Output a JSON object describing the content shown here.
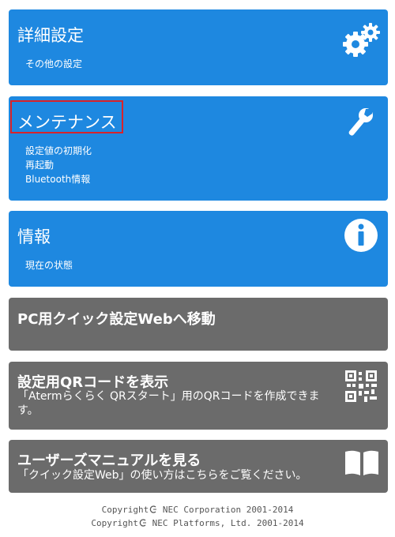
{
  "menu": {
    "advanced": {
      "title": "詳細設定",
      "items": [
        "その他の設定"
      ]
    },
    "maintenance": {
      "title": "メンテナンス",
      "items": [
        "設定値の初期化",
        "再起動",
        "Bluetooth情報"
      ]
    },
    "info": {
      "title": "情報",
      "items": [
        "現在の状態"
      ]
    },
    "pc_web": {
      "title": "PC用クイック設定Webへ移動"
    },
    "qr": {
      "title": "設定用QRコードを表示",
      "desc": "「Atermらくらく QRスタート」用のQRコードを作成できます。"
    },
    "manual": {
      "title": "ユーザーズマニュアルを見る",
      "desc": "「クイック設定Web」の使い方はこちらをご覧ください。"
    }
  },
  "footer": {
    "line1": "Copyright",
    "line1_rest": " NEC Corporation 2001-2014",
    "line2": "Copyright",
    "line2_rest": " NEC Platforms, Ltd. 2001-2014"
  },
  "icons": {
    "advanced": "gears-icon",
    "maintenance": "wrench-icon",
    "info": "info-icon",
    "qr": "qr-code-icon",
    "manual": "book-icon"
  },
  "colors": {
    "blue": "#1e88e0",
    "gray": "#6b6b6b",
    "highlight": "#d8232a"
  }
}
